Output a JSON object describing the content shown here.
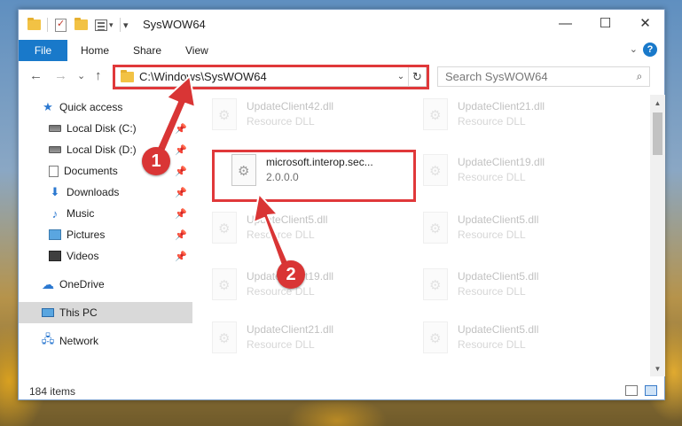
{
  "window": {
    "title": "SysWOW64",
    "minimize_glyph": "—",
    "maximize_glyph": "☐",
    "close_glyph": "✕"
  },
  "ribbon": {
    "tabs": [
      "File",
      "Home",
      "Share",
      "View"
    ],
    "help_glyph": "?",
    "expand_glyph": "⌄"
  },
  "nav": {
    "back_glyph": "←",
    "forward_glyph": "→",
    "recent_glyph": "⌄",
    "up_glyph": "↑",
    "address": "C:\\Windows\\SysWOW64",
    "address_dropdown_glyph": "⌄",
    "refresh_glyph": "↻",
    "search_placeholder": "Search SysWOW64",
    "search_glyph": "⌕"
  },
  "sidebar": {
    "items": [
      {
        "label": "Quick access",
        "icon": "star-icon",
        "pinned": false
      },
      {
        "label": "Local Disk (C:)",
        "icon": "drive-icon",
        "pinned": true
      },
      {
        "label": "Local Disk (D:)",
        "icon": "drive-icon",
        "pinned": true
      },
      {
        "label": "Documents",
        "icon": "documents-icon",
        "pinned": true
      },
      {
        "label": "Downloads",
        "icon": "download-icon",
        "pinned": true
      },
      {
        "label": "Music",
        "icon": "music-icon",
        "pinned": true
      },
      {
        "label": "Pictures",
        "icon": "pictures-icon",
        "pinned": true
      },
      {
        "label": "Videos",
        "icon": "videos-icon",
        "pinned": true
      },
      {
        "label": "OneDrive",
        "icon": "cloud-icon",
        "pinned": false
      },
      {
        "label": "This PC",
        "icon": "computer-icon",
        "pinned": false,
        "selected": true
      },
      {
        "label": "Network",
        "icon": "network-icon",
        "pinned": false
      }
    ],
    "pin_glyph": "📌"
  },
  "files": [
    {
      "name": "UpdateClient42.dll",
      "desc": "Resource DLL",
      "faded": true
    },
    {
      "name": "UpdateClient21.dll",
      "desc": "Resource DLL",
      "faded": true
    },
    {
      "name": "microsoft.interop.sec...",
      "desc": "2.0.0.0",
      "faded": false,
      "highlighted": true
    },
    {
      "name": "UpdateClient19.dll",
      "desc": "Resource DLL",
      "faded": true
    },
    {
      "name": "UpdateClient5.dll",
      "desc": "Resource DLL",
      "faded": true
    },
    {
      "name": "UpdateClient5.dll",
      "desc": "Resource DLL",
      "faded": true
    },
    {
      "name": "UpdateClient19.dll",
      "desc": "Resource DLL",
      "faded": true
    },
    {
      "name": "UpdateClient5.dll",
      "desc": "Resource DLL",
      "faded": true
    },
    {
      "name": "UpdateClient21.dll",
      "desc": "Resource DLL",
      "faded": true
    },
    {
      "name": "UpdateClient5.dll",
      "desc": "Resource DLL",
      "faded": true
    }
  ],
  "status": {
    "item_count": "184 items"
  },
  "scroll": {
    "up_glyph": "▲",
    "down_glyph": "▼"
  },
  "callouts": [
    "1",
    "2"
  ],
  "colors": {
    "accent": "#1979ca",
    "highlight": "#e0383a",
    "callout": "#d93535"
  }
}
